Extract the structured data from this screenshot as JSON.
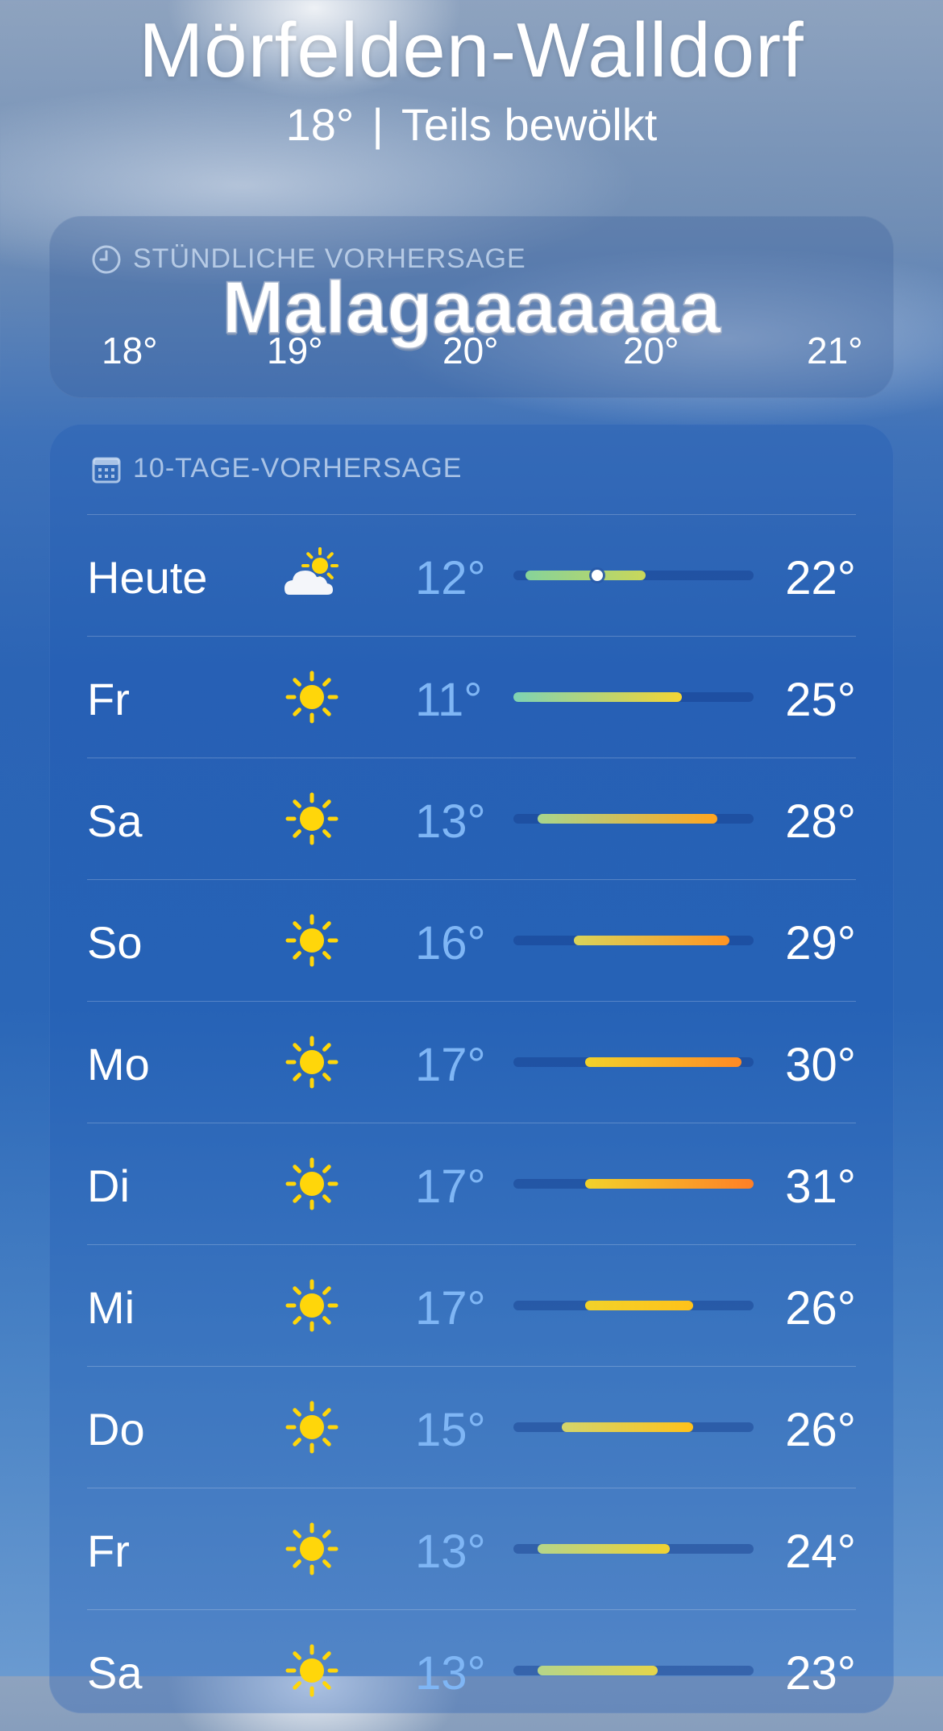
{
  "header": {
    "city": "Mörfelden-Walldorf",
    "current_temp": "18°",
    "separator": "|",
    "condition": "Teils bewölkt"
  },
  "hourly": {
    "title": "STÜNDLICHE VORHERSAGE",
    "overlay_text": "Malagaaaaaaa",
    "temps": [
      "18°",
      "19°",
      "20°",
      "20°",
      "21°"
    ]
  },
  "daily": {
    "title": "10-TAGE-VORHERSAGE",
    "range_min": 11,
    "range_max": 31,
    "rows": [
      {
        "day": "Heute",
        "icon": "partly-cloudy-icon",
        "low": "12°",
        "high": "22°",
        "low_val": 12,
        "high_val": 22,
        "current_val": 18,
        "bar_colors": [
          "#86d39a",
          "#c9d75a"
        ]
      },
      {
        "day": "Fr",
        "icon": "sun-icon",
        "low": "11°",
        "high": "25°",
        "low_val": 11,
        "high_val": 25,
        "bar_colors": [
          "#7ed3b4",
          "#f4d534"
        ]
      },
      {
        "day": "Sa",
        "icon": "sun-icon",
        "low": "13°",
        "high": "28°",
        "low_val": 13,
        "high_val": 28,
        "bar_colors": [
          "#a8d68d",
          "#ffa51f"
        ]
      },
      {
        "day": "So",
        "icon": "sun-icon",
        "low": "16°",
        "high": "29°",
        "low_val": 16,
        "high_val": 29,
        "bar_colors": [
          "#d9d45a",
          "#ff9421"
        ]
      },
      {
        "day": "Mo",
        "icon": "sun-icon",
        "low": "17°",
        "high": "30°",
        "low_val": 17,
        "high_val": 30,
        "bar_colors": [
          "#f2d22a",
          "#ff8a24"
        ]
      },
      {
        "day": "Di",
        "icon": "sun-icon",
        "low": "17°",
        "high": "31°",
        "low_val": 17,
        "high_val": 31,
        "bar_colors": [
          "#f2d22a",
          "#ff7f26"
        ]
      },
      {
        "day": "Mi",
        "icon": "sun-icon",
        "low": "17°",
        "high": "26°",
        "low_val": 17,
        "high_val": 26,
        "bar_colors": [
          "#f2d22a",
          "#ffc21a"
        ]
      },
      {
        "day": "Do",
        "icon": "sun-icon",
        "low": "15°",
        "high": "26°",
        "low_val": 15,
        "high_val": 26,
        "bar_colors": [
          "#d3d56c",
          "#ffc21a"
        ]
      },
      {
        "day": "Fr",
        "icon": "sun-icon",
        "low": "13°",
        "high": "24°",
        "low_val": 13,
        "high_val": 24,
        "bar_colors": [
          "#b5d58a",
          "#f0d232"
        ]
      },
      {
        "day": "Sa",
        "icon": "sun-icon",
        "low": "13°",
        "high": "23°",
        "low_val": 13,
        "high_val": 23,
        "bar_colors": [
          "#b5d58a",
          "#e5d54a"
        ]
      }
    ]
  },
  "colors": {
    "sun": "#ffd60a",
    "low_temp_text": "#7fb6f5"
  }
}
